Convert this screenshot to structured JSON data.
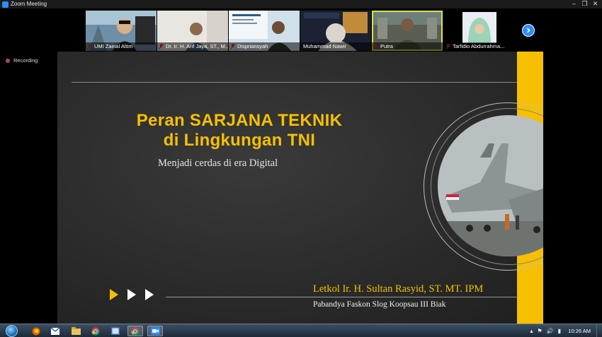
{
  "window": {
    "title": "Zoom Meeting",
    "controls": [
      "–",
      "❐",
      "✕"
    ]
  },
  "participants": [
    {
      "name": "UMI Zainal Altim",
      "muted": true
    },
    {
      "name": "Dr. Ir. H. Arif Jaya, ST., M...",
      "muted": true
    },
    {
      "name": "Dispriansyah",
      "muted": true
    },
    {
      "name": "Muhammad Nawir",
      "muted": false
    },
    {
      "name": "Putra",
      "muted": true,
      "active": true
    },
    {
      "name": "Tarfidio Abdurrahma...",
      "muted": true
    }
  ],
  "recording": {
    "label": "Recording"
  },
  "slide": {
    "title_line1": "Peran SARJANA TEKNIK",
    "title_line2": "di Lingkungan TNI",
    "subtitle": "Menjadi cerdas di era Digital",
    "speaker": "Letkol Ir. H. Sultan Rasyid, ST. MT. IPM",
    "position": "Pabandya Faskon Slog Koopsau III Biak"
  },
  "taskbar": {
    "apps": [
      "firefox-icon",
      "mail-icon",
      "explorer-icon",
      "chrome-icon",
      "media-icon",
      "chrome-icon",
      "zoom-icon"
    ],
    "tray": {
      "chevron": "▴",
      "flag": "⚑",
      "speaker": "🔊",
      "signal": "▮"
    },
    "clock": "10:26 AM"
  },
  "colors": {
    "accent_yellow": "#f6c000",
    "zoom_blue": "#2d8cff",
    "active_outline": "#d9e44a"
  }
}
